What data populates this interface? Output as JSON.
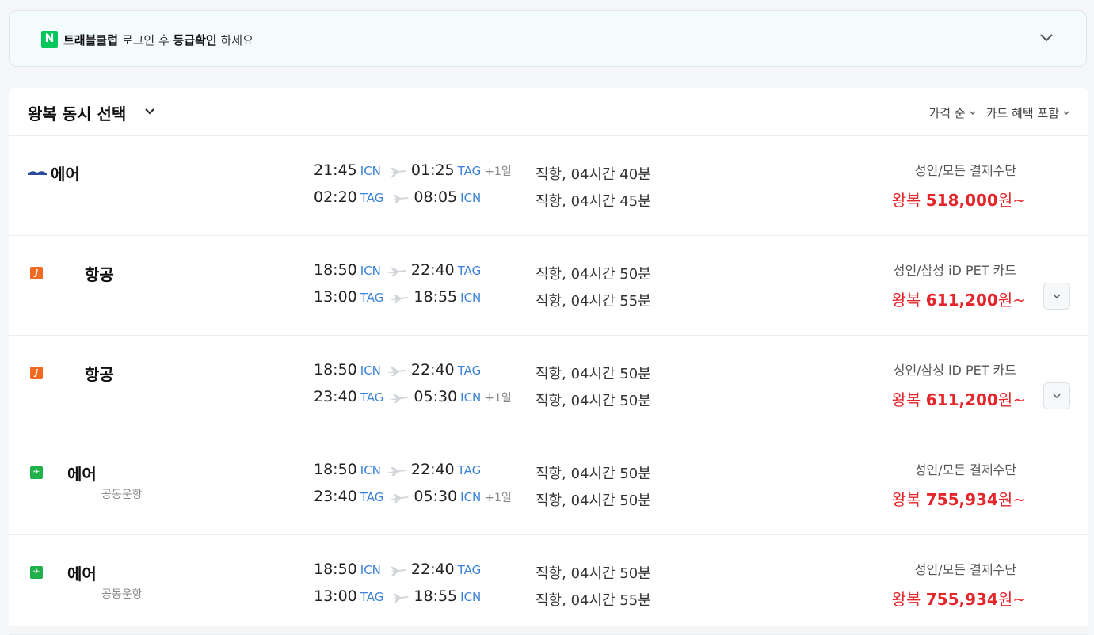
{
  "banner": {
    "logo": "N",
    "brand": "트래블클럽",
    "text_mid": " 로그인 후 ",
    "emphasis": "등급확인",
    "text_end": " 하세요",
    "chevron_icon": "chevron-down-icon"
  },
  "header": {
    "title": "왕복 동시 선택",
    "sort_label": "가격 순",
    "filter_label": "카드 혜택 포함"
  },
  "colors": {
    "accent_price": "#e5252a",
    "airport_code": "#3b82d6",
    "naver_green": "#03c75a"
  },
  "flights": [
    {
      "airline": "에어",
      "logo": "airbusan-logo",
      "operator_note": "",
      "outbound": {
        "dep_time": "21:45",
        "dep_ap": "ICN",
        "arr_time": "01:25",
        "arr_ap": "TAG",
        "plus": "+1일"
      },
      "inbound": {
        "dep_time": "02:20",
        "dep_ap": "TAG",
        "arr_time": "08:05",
        "arr_ap": "ICN",
        "plus": ""
      },
      "out_duration": "직항, 04시간 40분",
      "in_duration": "직항, 04시간 45분",
      "payment": "성인/모든 결제수단",
      "price_prefix": "왕복 ",
      "price_amount": "518,000",
      "price_suffix": "원~"
    },
    {
      "airline": "항공",
      "logo": "jejuair-logo",
      "operator_note": "",
      "outbound": {
        "dep_time": "18:50",
        "dep_ap": "ICN",
        "arr_time": "22:40",
        "arr_ap": "TAG",
        "plus": ""
      },
      "inbound": {
        "dep_time": "13:00",
        "dep_ap": "TAG",
        "arr_time": "18:55",
        "arr_ap": "ICN",
        "plus": ""
      },
      "out_duration": "직항, 04시간 50분",
      "in_duration": "직항, 04시간 55분",
      "payment": "성인/삼성 iD PET 카드",
      "price_prefix": "왕복 ",
      "price_amount": "611,200",
      "price_suffix": "원~"
    },
    {
      "airline": "항공",
      "logo": "jejuair-logo",
      "operator_note": "",
      "outbound": {
        "dep_time": "18:50",
        "dep_ap": "ICN",
        "arr_time": "22:40",
        "arr_ap": "TAG",
        "plus": ""
      },
      "inbound": {
        "dep_time": "23:40",
        "dep_ap": "TAG",
        "arr_time": "05:30",
        "arr_ap": "ICN",
        "plus": "+1일"
      },
      "out_duration": "직항, 04시간 50분",
      "in_duration": "직항, 04시간 50분",
      "payment": "성인/삼성 iD PET 카드",
      "price_prefix": "왕복 ",
      "price_amount": "611,200",
      "price_suffix": "원~"
    },
    {
      "airline": "에어",
      "logo": "jinair-logo",
      "operator_note": "공동운항",
      "outbound": {
        "dep_time": "18:50",
        "dep_ap": "ICN",
        "arr_time": "22:40",
        "arr_ap": "TAG",
        "plus": ""
      },
      "inbound": {
        "dep_time": "23:40",
        "dep_ap": "TAG",
        "arr_time": "05:30",
        "arr_ap": "ICN",
        "plus": "+1일"
      },
      "out_duration": "직항, 04시간 50분",
      "in_duration": "직항, 04시간 50분",
      "payment": "성인/모든 결제수단",
      "price_prefix": "왕복 ",
      "price_amount": "755,934",
      "price_suffix": "원~"
    },
    {
      "airline": "에어",
      "logo": "jinair-logo",
      "operator_note": "공동운항",
      "outbound": {
        "dep_time": "18:50",
        "dep_ap": "ICN",
        "arr_time": "22:40",
        "arr_ap": "TAG",
        "plus": ""
      },
      "inbound": {
        "dep_time": "13:00",
        "dep_ap": "TAG",
        "arr_time": "18:55",
        "arr_ap": "ICN",
        "plus": ""
      },
      "out_duration": "직항, 04시간 50분",
      "in_duration": "직항, 04시간 55분",
      "payment": "성인/모든 결제수단",
      "price_prefix": "왕복 ",
      "price_amount": "755,934",
      "price_suffix": "원~"
    }
  ]
}
